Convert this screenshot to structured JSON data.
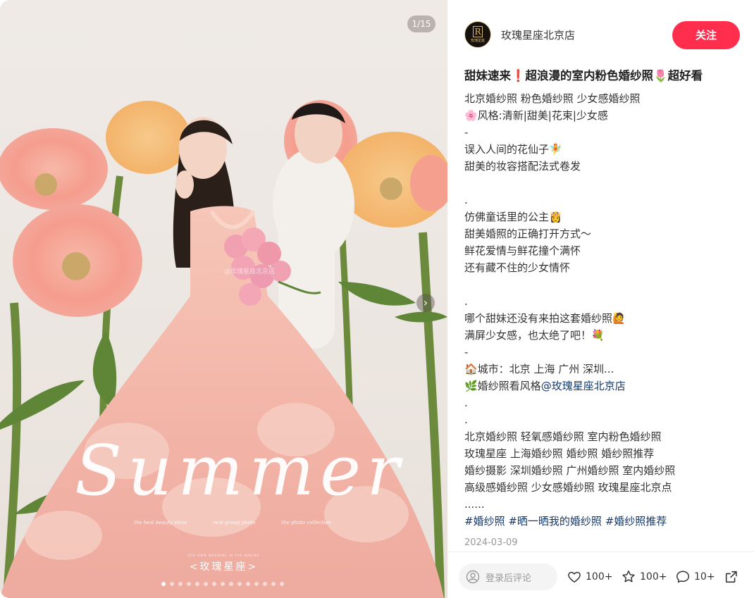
{
  "media": {
    "counter": "1/15",
    "script_word": "Summer",
    "credits": [
      "the best beauty show",
      "new group photo",
      "the photo collection"
    ],
    "tagline": "OUR OWN WEDDING IN THE MAKING",
    "brand_mark": "<玫瑰星座>",
    "watermark": "@玫瑰星座北京店",
    "dot_count": 15,
    "active_dot": 0
  },
  "author": {
    "name": "玫瑰星座北京店",
    "avatar_letter": "R",
    "avatar_text": "玫瑰星座"
  },
  "follow_label": "关注",
  "note": {
    "title": "甜妹速来❗超浪漫的室内粉色婚纱照🌷超好看",
    "lines": [
      "北京婚纱照 粉色婚纱照 少女感婚纱照",
      "🌸风格:清新|甜美|花束|少女感",
      "-",
      "误入人间的花仙子🧚",
      "甜美的妆容搭配法式卷发",
      "",
      ".",
      "仿佛童话里的公主👸",
      "甜美婚照的正确打开方式～",
      "鲜花爱情与鲜花撞个满怀",
      "还有藏不住的少女情怀",
      "",
      ".",
      "哪个甜妹还没有来拍这套婚纱照🙋",
      "满屏少女感，也太绝了吧！💐",
      "-",
      "🏠城市：北京 上海 广州 深圳...",
      "🌿婚纱照看风格"
    ],
    "mention": "@玫瑰星座北京店",
    "lines2": [
      ".",
      ".",
      "北京婚纱照 轻氧感婚纱照 室内粉色婚纱照",
      "玫瑰星座 上海婚纱照 婚纱照 婚纱照推荐",
      "婚纱摄影 深圳婚纱照 广州婚纱照 室内婚纱照",
      "高级感婚纱照 少女感婚纱照 玫瑰星座北京点",
      "......"
    ],
    "tags": [
      "#婚纱照",
      "#晒一晒我的婚纱照",
      "#婚纱照推荐"
    ],
    "date": "2024-03-09"
  },
  "bottom": {
    "comment_placeholder": "登录后评论",
    "likes": "100+",
    "collects": "100+",
    "comments": "10+"
  },
  "icons": {
    "next": "chevron-right-icon",
    "like": "heart-icon",
    "collect": "star-icon",
    "comment": "comment-bubble-icon",
    "share": "share-icon",
    "user": "user-icon"
  },
  "colors": {
    "follow": "#ff2e4d",
    "tag": "#13386c",
    "muted": "#999999"
  }
}
